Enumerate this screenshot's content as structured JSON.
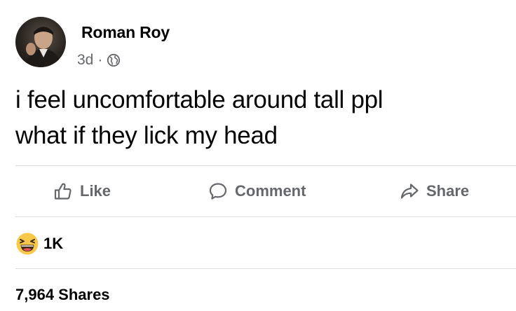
{
  "post": {
    "author": "Roman Roy",
    "time": "3d",
    "separator": "·",
    "privacy_icon": "globe-icon",
    "text_lines": [
      "i feel uncomfortable around tall ppl",
      "what if they lick my head"
    ]
  },
  "actions": {
    "like": {
      "label": "Like",
      "icon": "thumbs-up-icon"
    },
    "comment": {
      "label": "Comment",
      "icon": "comment-bubble-icon"
    },
    "share": {
      "label": "Share",
      "icon": "share-arrow-icon"
    }
  },
  "reactions": {
    "icon": "laughing-emoji-icon",
    "count": "1K"
  },
  "shares": {
    "text": "7,964 Shares"
  },
  "colors": {
    "text_primary": "#050505",
    "text_secondary": "#65676b",
    "divider": "#dadde1",
    "reaction_yellow": "#f7c84a"
  }
}
